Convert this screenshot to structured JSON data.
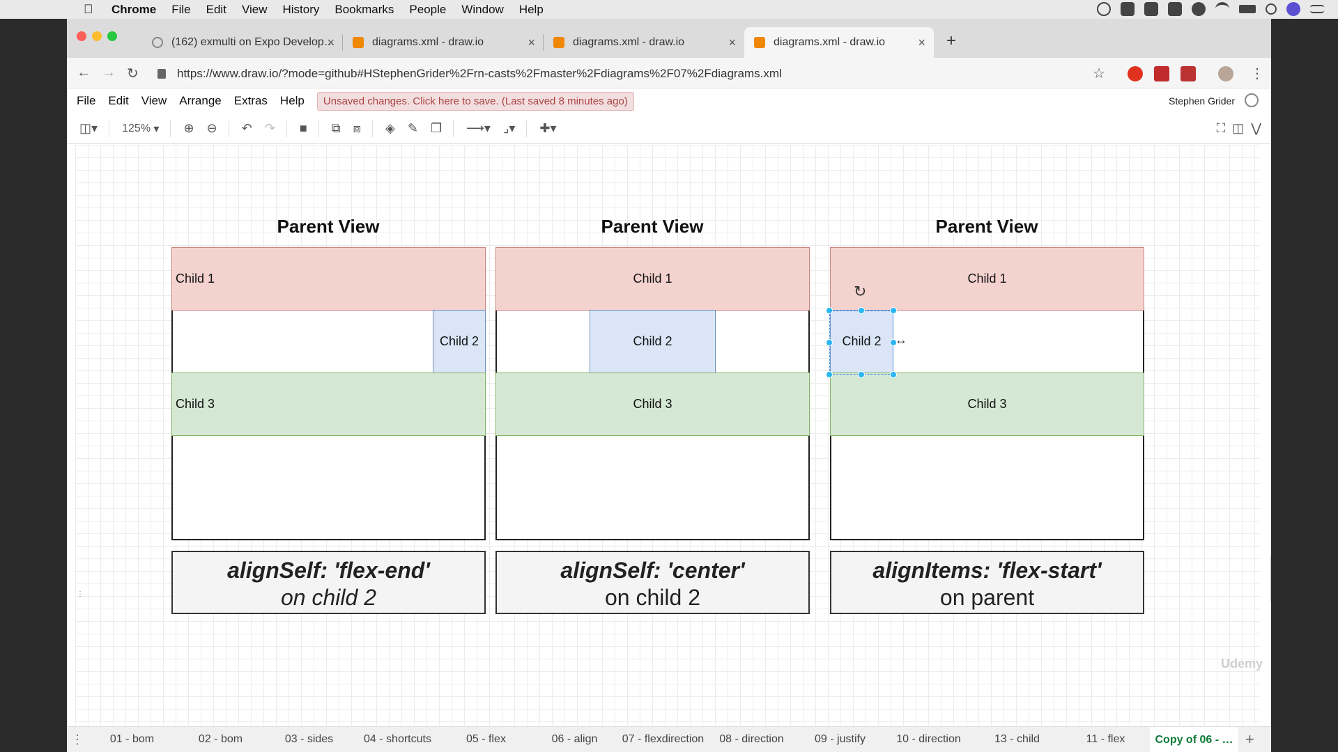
{
  "mac_menu": {
    "app": "Chrome",
    "items": [
      "File",
      "Edit",
      "View",
      "History",
      "Bookmarks",
      "People",
      "Window",
      "Help"
    ]
  },
  "tabs": [
    {
      "title": "(162) exmulti on Expo Develop…"
    },
    {
      "title": "diagrams.xml - draw.io"
    },
    {
      "title": "diagrams.xml - draw.io"
    },
    {
      "title": "diagrams.xml - draw.io"
    }
  ],
  "address_bar": {
    "url": "https://www.draw.io/?mode=github#HStephenGrider%2Frn-casts%2Fmaster%2Fdiagrams%2F07%2Fdiagrams.xml"
  },
  "drawio_menu": {
    "items": [
      "File",
      "Edit",
      "View",
      "Arrange",
      "Extras",
      "Help"
    ],
    "unsaved_notice": "Unsaved changes. Click here to save. (Last saved 8 minutes ago)",
    "user": "Stephen Grider"
  },
  "toolbar": {
    "zoom": "125%"
  },
  "diagram": {
    "panels": [
      {
        "title": "Parent View",
        "child1": "Child 1",
        "child2": "Child 2",
        "child3": "Child 3",
        "note_line1": "alignSelf: 'flex-end'",
        "note_line2": "on child 2"
      },
      {
        "title": "Parent View",
        "child1": "Child 1",
        "child2": "Child 2",
        "child3": "Child 3",
        "note_line1": "alignSelf: 'center'",
        "note_line2": "on child 2"
      },
      {
        "title": "Parent View",
        "child1": "Child 1",
        "child2": "Child 2",
        "child3": "Child 3",
        "note_line1": "alignItems: 'flex-start'",
        "note_line2": "on parent"
      }
    ],
    "colors": {
      "child1": "#f4d3cf",
      "child2": "#dae6f8",
      "child3": "#d5e8d4",
      "selection": "#29b6f2"
    }
  },
  "watermark": "Udemy",
  "page_tabs": [
    "01 - bom",
    "02 - bom",
    "03 - sides",
    "04 - shortcuts",
    "05 - flex",
    "06 - align",
    "07 - flexdirection",
    "08 - direction",
    "09 - justify",
    "10 - direction",
    "13 - child",
    "11 - flex",
    "Copy of 06 - …"
  ],
  "active_page_tab": "Copy of 06 - …"
}
